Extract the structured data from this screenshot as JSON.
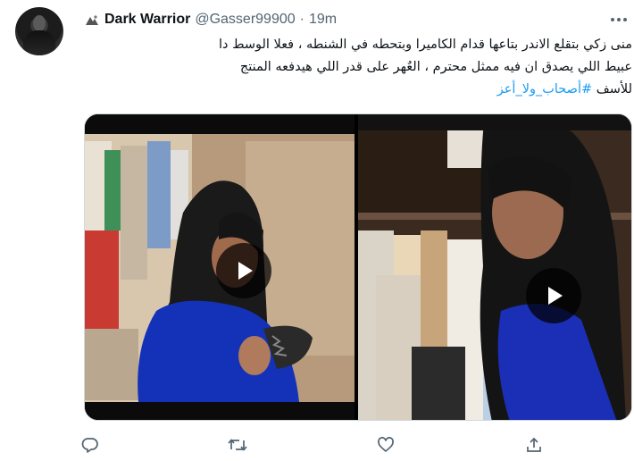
{
  "author": {
    "display_name": "Dark Warrior",
    "handle": "@Gasser99900",
    "separator": "·",
    "time": "19m",
    "avatar_icon": "profile-avatar",
    "badge_icon": "verified-badge-icon"
  },
  "tweet": {
    "line1": "منى زكي بتقلع الاندر بتاعها قدام الكاميرا وبتحطه في الشنطه ، فعلا الوسط دا",
    "line2": "عبيط اللي يصدق ان فيه ممثل محترم ، العٌهر على قدر اللي هيدفعه المنتج",
    "line3_text": "للأسف",
    "hashtag": "#أصحاب_ولا_أعز"
  },
  "media": {
    "videos": [
      {
        "name": "video-left",
        "play_icon": "play-icon"
      },
      {
        "name": "video-right",
        "play_icon": "play-icon"
      }
    ]
  },
  "actions": {
    "reply_icon": "reply-icon",
    "retweet_icon": "retweet-icon",
    "like_icon": "like-icon",
    "share_icon": "share-icon"
  },
  "colors": {
    "text_primary": "#0f1419",
    "text_secondary": "#536471",
    "link": "#1d9bf0",
    "border": "#cfd9de"
  }
}
